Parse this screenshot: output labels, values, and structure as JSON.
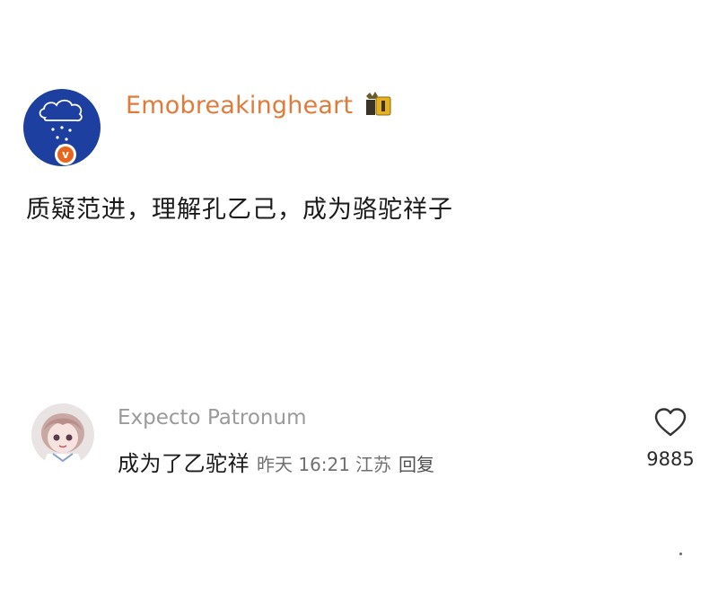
{
  "post": {
    "username": "Emobreakingheart",
    "verified_badge_letter": "v",
    "text": "质疑范进，理解孔乙己，成为骆驼祥子",
    "username_color": "#e07b3a",
    "avatar_color": "#1d3fa0",
    "vip_icon": "vip-badge-icon"
  },
  "comment": {
    "username": "Expecto Patronum",
    "text": "成为了乙驼祥",
    "time": "昨天 16:21",
    "location": "江苏",
    "reply_label": "回复",
    "like_count": "9885",
    "like_icon": "heart-outline-icon"
  }
}
